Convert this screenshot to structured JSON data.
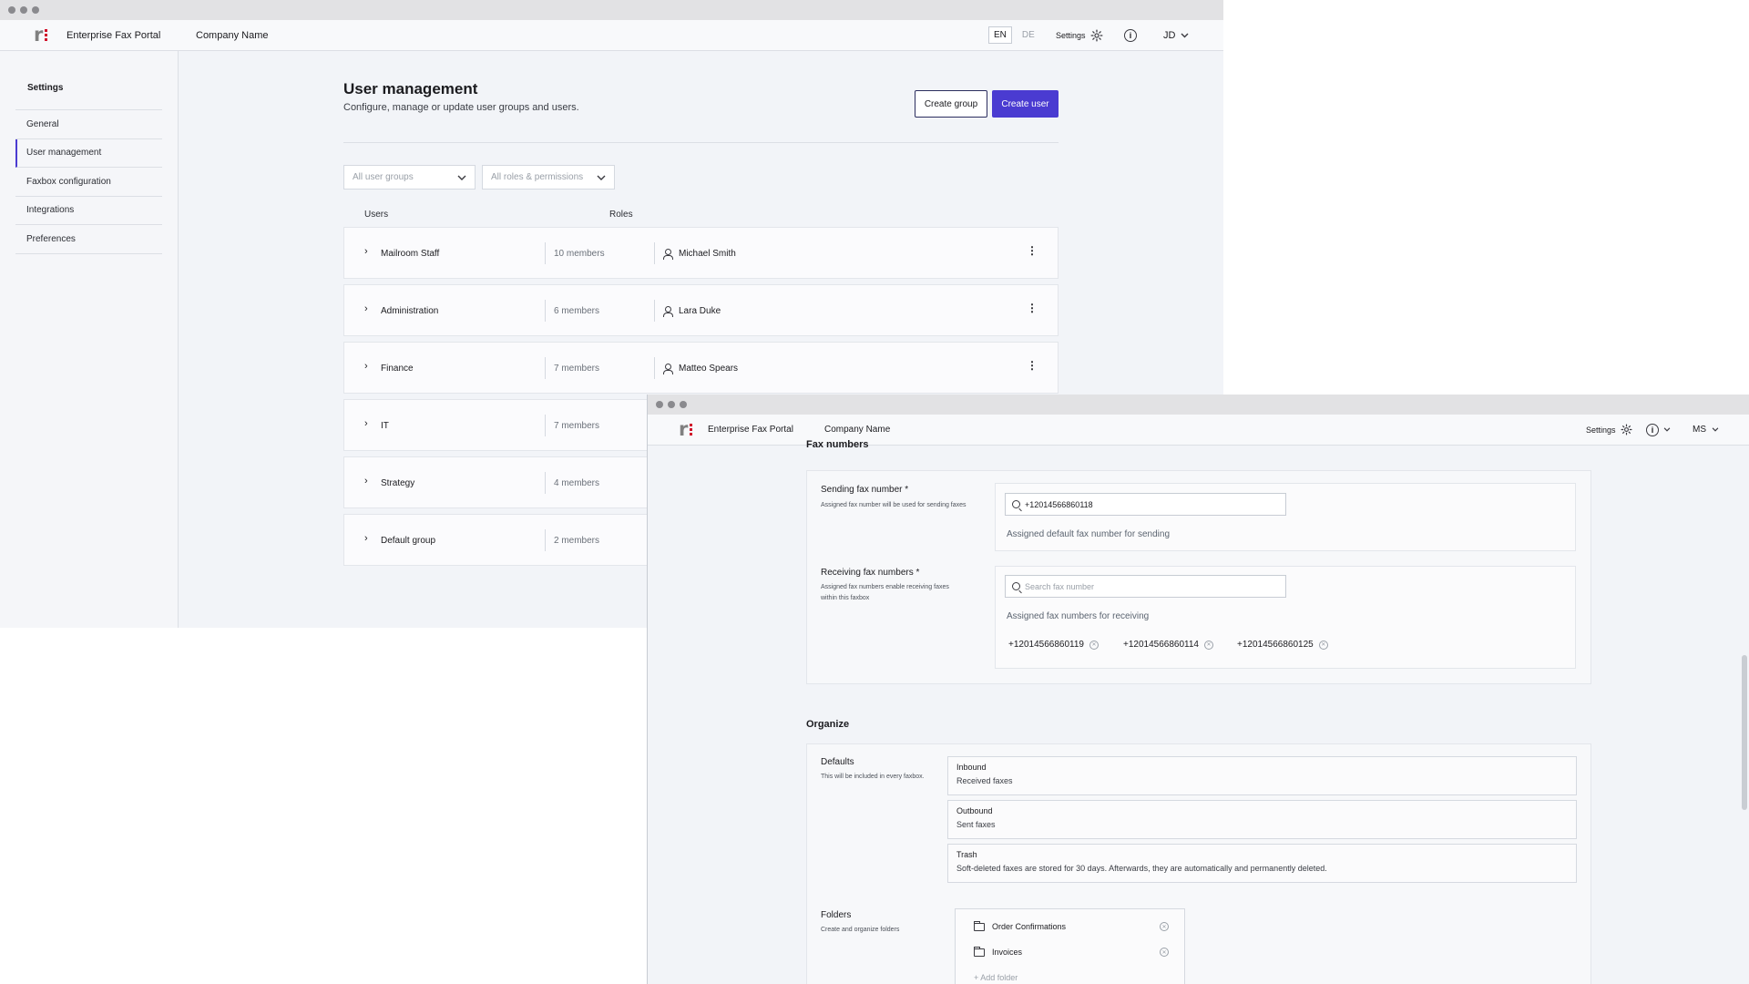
{
  "app": {
    "portal_name": "Enterprise Fax Portal",
    "company": "Company Name",
    "lang_en": "EN",
    "lang_de": "DE",
    "settings_label": "Settings",
    "user_initials_a": "JD",
    "user_initials_b": "MS",
    "accent_color": "#4a3bd1",
    "logo_dot_color": "#d0102a"
  },
  "sidebar": {
    "heading": "Settings",
    "items": [
      {
        "label": "General"
      },
      {
        "label": "User management"
      },
      {
        "label": "Faxbox configuration"
      },
      {
        "label": "Integrations"
      },
      {
        "label": "Preferences"
      }
    ],
    "active": "User management"
  },
  "user_management": {
    "title": "User management",
    "subtitle": "Configure, manage or update user groups and users.",
    "create_group_label": "Create group",
    "create_user_label": "Create user",
    "filter_groups": "All user groups",
    "filter_roles": "All roles & permissions",
    "col_users": "Users",
    "col_roles": "Roles",
    "groups": [
      {
        "name": "Mailroom Staff",
        "members": "10 members",
        "role": "Michael Smith"
      },
      {
        "name": "Administration",
        "members": "6 members",
        "role": "Lara Duke"
      },
      {
        "name": "Finance",
        "members": "7 members",
        "role": "Matteo Spears"
      },
      {
        "name": "IT",
        "members": "7 members"
      },
      {
        "name": "Strategy",
        "members": "4 members"
      },
      {
        "name": "Default group",
        "members": "2 members"
      }
    ]
  },
  "faxbox": {
    "fax_numbers_title": "Fax numbers",
    "sending_label": "Sending fax number *",
    "sending_help": "Assigned fax number will be used for sending faxes",
    "sending_value": "+12014566860118",
    "sending_note": "Assigned default fax number for sending",
    "receiving_label": "Receiving fax numbers *",
    "receiving_help": "Assigned fax numbers enable receiving faxes within this faxbox",
    "receiving_placeholder": "Search fax number",
    "receiving_note": "Assigned fax numbers for receiving",
    "receiving_numbers": [
      "+12014566860119",
      "+12014566860114",
      "+12014566860125"
    ],
    "organize_title": "Organize",
    "defaults_label": "Defaults",
    "defaults_help": "This will be included in every faxbox.",
    "defaults": [
      {
        "title": "Inbound",
        "desc": "Received faxes"
      },
      {
        "title": "Outbound",
        "desc": "Sent faxes"
      },
      {
        "title": "Trash",
        "desc": "Soft-deleted faxes are stored for 30 days. Afterwards, they are automatically and permanently deleted."
      }
    ],
    "folders_label": "Folders",
    "folders_help": "Create and organize folders",
    "folders": [
      "Order Confirmations",
      "Invoices"
    ],
    "add_folder_label": "+ Add folder"
  }
}
